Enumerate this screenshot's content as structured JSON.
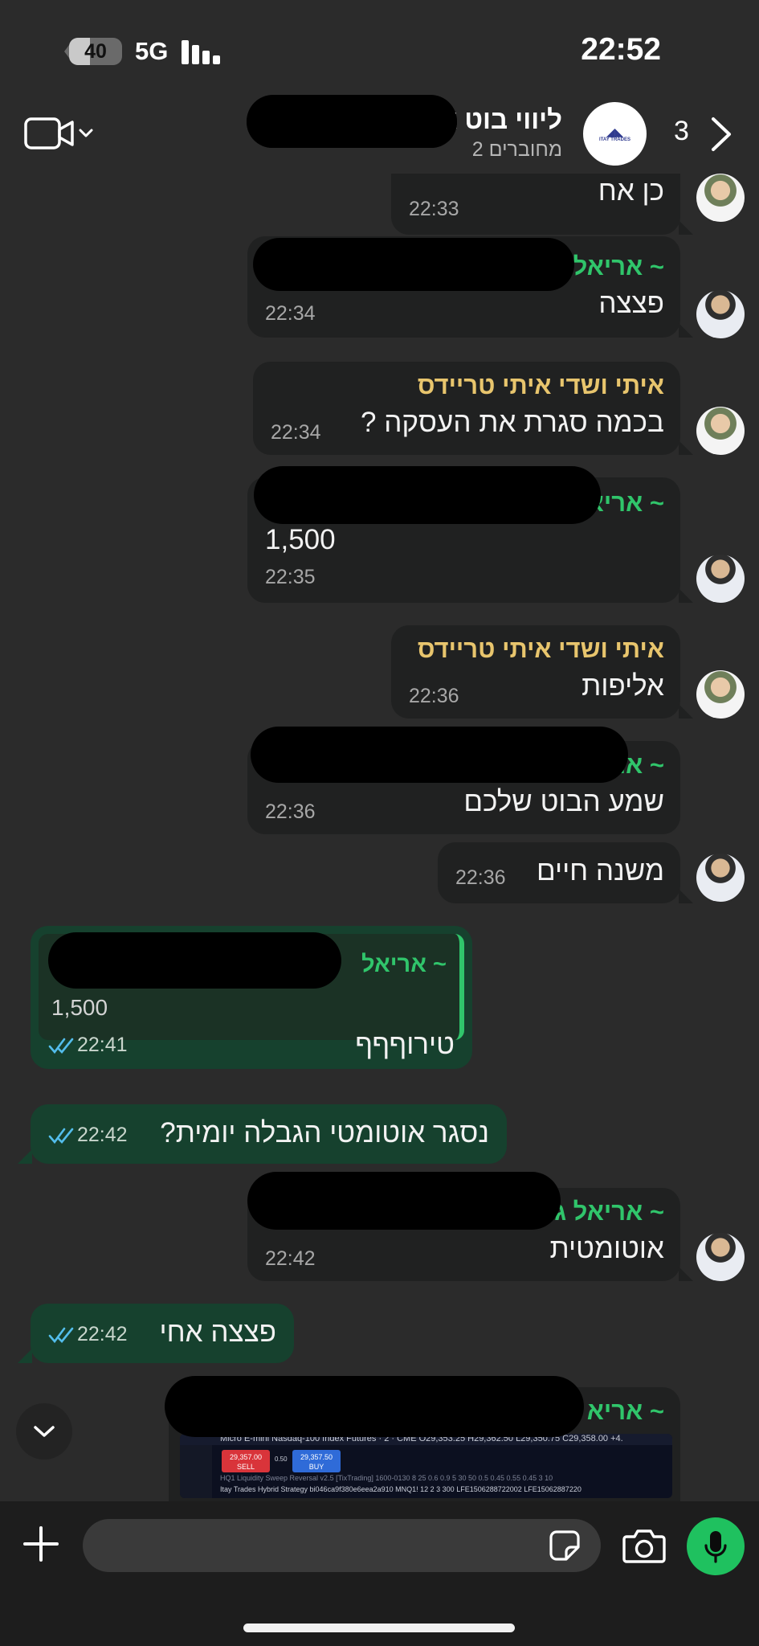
{
  "status_bar": {
    "battery": "40",
    "battery_level_percent": 40,
    "network": "5G",
    "time": "22:52"
  },
  "header": {
    "title": "ליווי בוט א",
    "subtitle": "2 מחוברים",
    "unread_count": "3",
    "group_avatar": {
      "mark": "◢◣",
      "label": "ITAY TRADES"
    }
  },
  "messages": [
    {
      "dir": "in",
      "sender": "",
      "text": "כן אח",
      "time": "22:33"
    },
    {
      "dir": "in",
      "sender": "~ אריאל",
      "text": "פצצה",
      "time": "22:34"
    },
    {
      "dir": "in",
      "sender": "איתי ושדי איתי טריידס",
      "text": "בכמה סגרת את העסקה ?",
      "time": "22:34"
    },
    {
      "dir": "in",
      "sender": "~ אריא",
      "text": "1,500",
      "time": "22:35"
    },
    {
      "dir": "in",
      "sender": "איתי ושדי איתי טריידס",
      "text": "אליפות",
      "time": "22:36"
    },
    {
      "dir": "in",
      "sender": "~ אר",
      "text": "שמע הבוט שלכם",
      "time": "22:36"
    },
    {
      "dir": "in",
      "sender": "",
      "text": "משנה חיים",
      "time": "22:36"
    },
    {
      "dir": "out",
      "quote_sender": "~ אריאל",
      "quote_text": "1,500",
      "text": "טירוףףף",
      "time": "22:41"
    },
    {
      "dir": "out",
      "text": "נסגר אוטומטי הגבלה יומית?",
      "time": "22:42"
    },
    {
      "dir": "in",
      "sender": "~ אריאל ג",
      "text": "אוטומטית",
      "time": "22:42"
    },
    {
      "dir": "out",
      "text": "פצצה אחי",
      "time": "22:42"
    },
    {
      "dir": "in",
      "sender": "~ אריא",
      "image": {
        "row1": "Micro E-mini Nasdaq-100 Index Futures · 2 · CME   O29,353.25 H29,362.50 L29,350.75 C29,358.00 +4.",
        "sell": "29,357.00",
        "sell_label": "SELL",
        "spread": "0.50",
        "buy": "29,357.50",
        "buy_label": "BUY",
        "row2": "HQ1 Liquidity Sweep Reversal v2.5 [TixTrading] 1600-0130 8 25 0.6 0.9 5 30 50 0.5 0.45 0.55 0.45 3 10",
        "row3": "Itay Trades Hybrid Strategy bi046ca9f380e6eea2a910 MNQ1! 12 2 3 300 LFE1506288722002 LFE15062887220"
      }
    }
  ],
  "input": {
    "placeholder": ""
  },
  "colors": {
    "background": "#2b2b2b",
    "incoming_bubble": "#202121",
    "outgoing_bubble": "#16412e",
    "sender_gold": "#e8c56d",
    "sender_green": "#30c56b",
    "mic_button": "#1fc15f",
    "read_ticks": "#53bdeb"
  },
  "icons": {
    "video": "video-camera-icon",
    "back": "chevron-right-icon",
    "scroll": "chevron-down-icon",
    "plus": "plus-icon",
    "sticker": "sticker-icon",
    "camera": "camera-icon",
    "mic": "microphone-icon"
  }
}
